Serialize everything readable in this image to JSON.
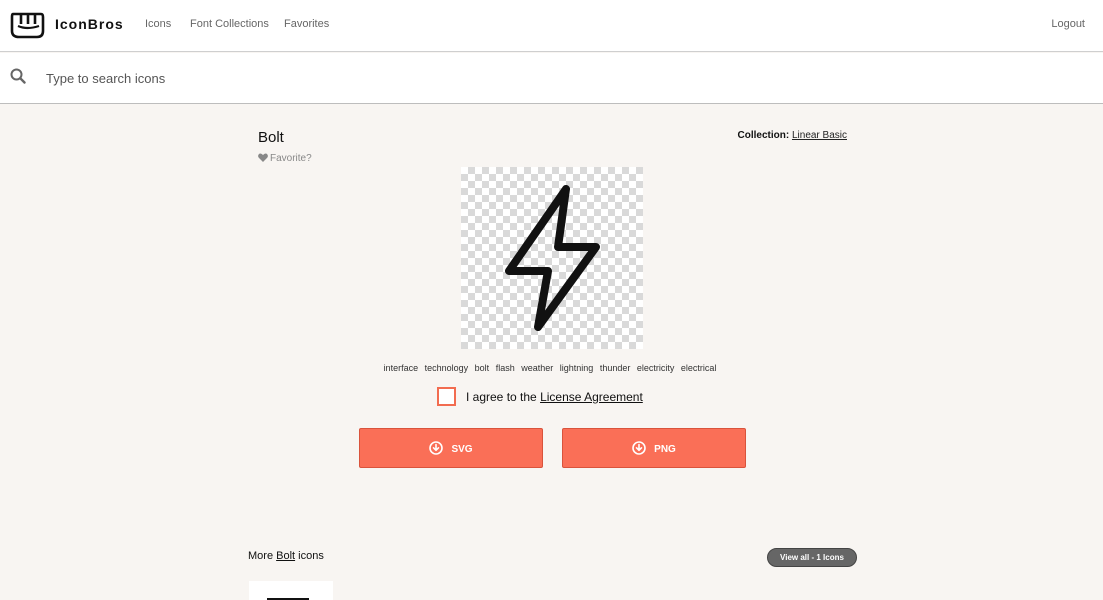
{
  "nav": {
    "brand": "IconBros",
    "links": [
      "Icons",
      "Font Collections",
      "Favorites"
    ],
    "logout": "Logout"
  },
  "search": {
    "placeholder": "Type to search icons",
    "icon": "search-icon"
  },
  "icon_detail": {
    "title": "Bolt",
    "favorite_label": "Favorite?",
    "collection_label": "Collection:",
    "collection_name": "Linear Basic",
    "preview_icon": "bolt-icon",
    "tags": [
      "interface",
      "technology",
      "bolt",
      "flash",
      "weather",
      "lightning",
      "thunder",
      "electricity",
      "electrical"
    ]
  },
  "license": {
    "prefix": "I agree to the",
    "link": "License Agreement",
    "checked": false
  },
  "downloads": {
    "svg_label": "SVG",
    "png_label": "PNG",
    "icon": "download-circle-icon"
  },
  "more": {
    "prefix": "More",
    "link": "Bolt",
    "suffix": "icons",
    "view_all": "View all - 1 Icons"
  },
  "colors": {
    "accent": "#fa6f57",
    "background": "#f8f5f2",
    "pill": "#666666"
  }
}
